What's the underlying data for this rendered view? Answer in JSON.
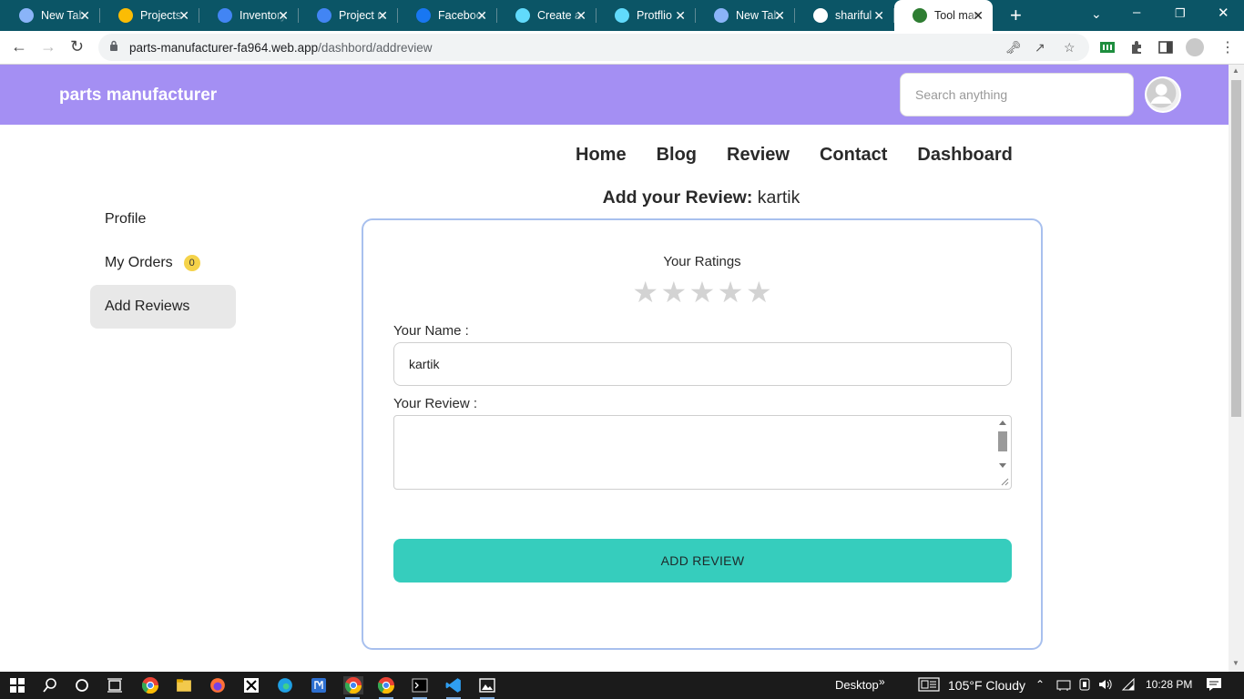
{
  "browser": {
    "tabs": [
      {
        "title": "New Tab",
        "icon": "chrome-icon",
        "color": "#8ab4f8"
      },
      {
        "title": "Projects",
        "icon": "google-drive-icon",
        "color": "#fbbc04"
      },
      {
        "title": "Inventory",
        "icon": "google-docs-icon",
        "color": "#4285f4"
      },
      {
        "title": "Project re",
        "icon": "google-docs-icon",
        "color": "#4285f4"
      },
      {
        "title": "Facebook",
        "icon": "facebook-icon",
        "color": "#1877f2"
      },
      {
        "title": "Create a",
        "icon": "react-icon",
        "color": "#61dafb"
      },
      {
        "title": "Protflio",
        "icon": "react-icon",
        "color": "#61dafb"
      },
      {
        "title": "New Tab",
        "icon": "chrome-icon",
        "color": "#8ab4f8"
      },
      {
        "title": "shariful",
        "icon": "github-icon",
        "color": "#ffffff"
      },
      {
        "title": "Tool man",
        "icon": "tool-icon",
        "color": "#2e7d32"
      }
    ],
    "active_tab": 9,
    "url_host": "parts-manufacturer-fa964.web.app",
    "url_path": "/dashbord/addreview"
  },
  "site": {
    "brand": "parts manufacturer",
    "search_placeholder": "Search anything",
    "header_color": "#a48ff3",
    "nav": [
      "Home",
      "Blog",
      "Review",
      "Contact",
      "Dashboard"
    ]
  },
  "page": {
    "heading_bold": "Add your Review:",
    "heading_user": "kartik"
  },
  "sidebar": {
    "items": [
      {
        "label": "Profile"
      },
      {
        "label": "My Orders",
        "badge": "0"
      },
      {
        "label": "Add Reviews",
        "active": true
      }
    ]
  },
  "form": {
    "ratings_label": "Your Ratings",
    "rating_value": 0,
    "rating_max": 5,
    "name_label": "Your Name :",
    "name_value": "kartik",
    "review_label": "Your Review :",
    "review_value": "",
    "submit_label": "ADD REVIEW",
    "submit_color": "#36cdbd"
  },
  "taskbar": {
    "desktop_label": "Desktop",
    "weather": "105°F  Cloudy",
    "time": "10:28 PM"
  }
}
